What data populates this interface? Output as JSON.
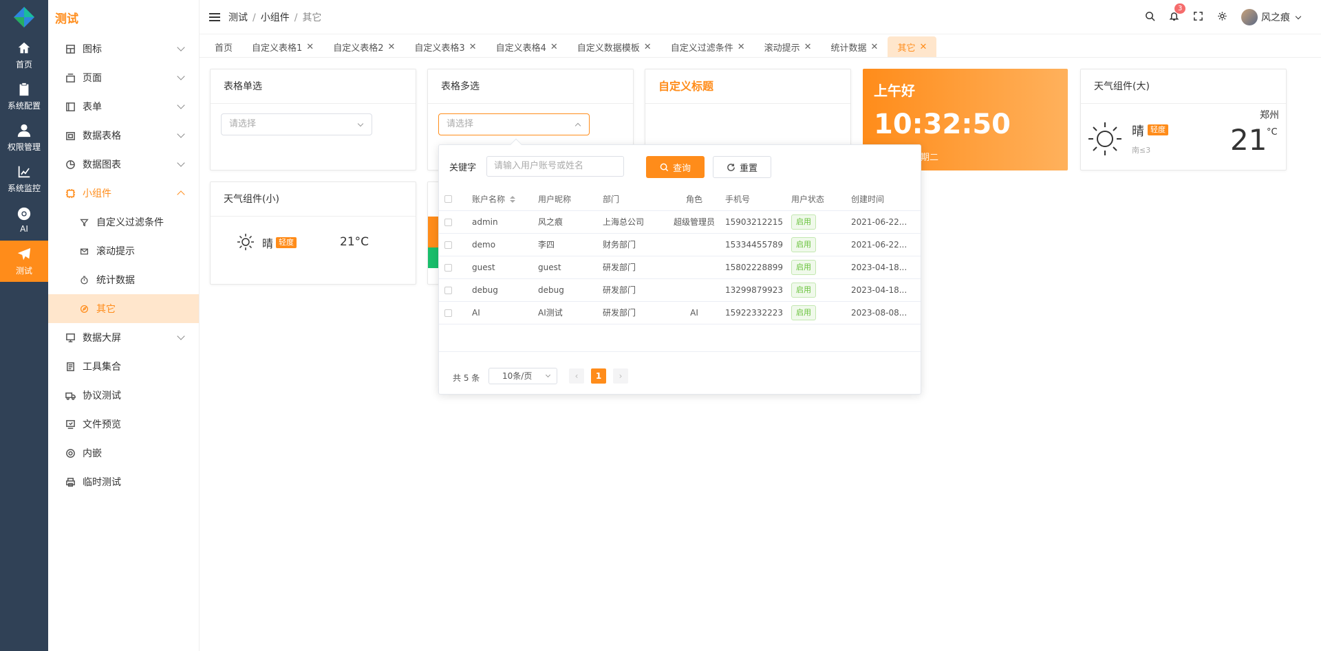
{
  "app": {
    "title": "测试"
  },
  "rail": [
    {
      "label": "首页",
      "icon": "home-icon"
    },
    {
      "label": "系统配置",
      "icon": "clipboard-icon"
    },
    {
      "label": "权限管理",
      "icon": "user-icon"
    },
    {
      "label": "系统监控",
      "icon": "chart-line-icon"
    },
    {
      "label": "AI",
      "icon": "chrome-icon"
    },
    {
      "label": "测试",
      "icon": "send-icon",
      "active": true
    }
  ],
  "menu": {
    "items": [
      {
        "label": "图标"
      },
      {
        "label": "页面"
      },
      {
        "label": "表单"
      },
      {
        "label": "数据表格"
      },
      {
        "label": "数据图表"
      },
      {
        "label": "小组件"
      },
      {
        "label": "自定义过滤条件"
      },
      {
        "label": "滚动提示"
      },
      {
        "label": "统计数据"
      },
      {
        "label": "其它"
      },
      {
        "label": "数据大屏"
      },
      {
        "label": "工具集合"
      },
      {
        "label": "协议测试"
      },
      {
        "label": "文件预览"
      },
      {
        "label": "内嵌"
      },
      {
        "label": "临时测试"
      }
    ]
  },
  "breadcrumb": {
    "items": [
      "测试",
      "小组件",
      "其它"
    ]
  },
  "header": {
    "notifications": "3",
    "user_name": "风之痕"
  },
  "tabs": [
    "首页",
    "自定义表格1",
    "自定义表格2",
    "自定义表格3",
    "自定义表格4",
    "自定义数据模板",
    "自定义过滤条件",
    "滚动提示",
    "统计数据",
    "其它"
  ],
  "cards": {
    "single": {
      "title": "表格单选",
      "placeholder": "请选择"
    },
    "multi": {
      "title": "表格多选",
      "placeholder": "请选择"
    },
    "custom": {
      "title": "自定义标题"
    },
    "greeting": {
      "hello": "上午好",
      "time": "10:32:50",
      "date": "月 03 日 星期二"
    },
    "weather_big": {
      "title": "天气组件(大)",
      "city": "郑州",
      "condition": "晴",
      "tag": "轻度",
      "temp": "21",
      "unit": "°C",
      "wind": "南≤3"
    },
    "weather_small": {
      "title": "天气组件(小)",
      "condition": "晴",
      "tag": "轻度",
      "temp": "21°C"
    }
  },
  "popover": {
    "keyword_label": "关键字",
    "keyword_placeholder": "请输入用户账号或姓名",
    "search_label": "查询",
    "reset_label": "重置",
    "columns": [
      "账户名称",
      "用户昵称",
      "部门",
      "角色",
      "手机号",
      "用户状态",
      "创建时间"
    ],
    "rows": [
      [
        "admin",
        "风之痕",
        "上海总公司",
        "超级管理员",
        "15903212215",
        "启用",
        "2021-06-22..."
      ],
      [
        "demo",
        "李四",
        "财务部门",
        "",
        "15334455789",
        "启用",
        "2021-06-22..."
      ],
      [
        "guest",
        "guest",
        "研发部门",
        "",
        "15802228899",
        "启用",
        "2023-04-18..."
      ],
      [
        "debug",
        "debug",
        "研发部门",
        "",
        "13299879923",
        "启用",
        "2023-04-18..."
      ],
      [
        "AI",
        "AI测试",
        "研发部门",
        "AI",
        "15922332223",
        "启用",
        "2023-08-08..."
      ]
    ],
    "total": "共 5 条",
    "page_size": "10条/页",
    "current_page": "1",
    "prev": "‹",
    "next": "›"
  },
  "colors": {
    "accent": "#ff8c1a",
    "rail": "#304156",
    "active_bg": "#ffe6cc",
    "success": "#67c23a"
  }
}
